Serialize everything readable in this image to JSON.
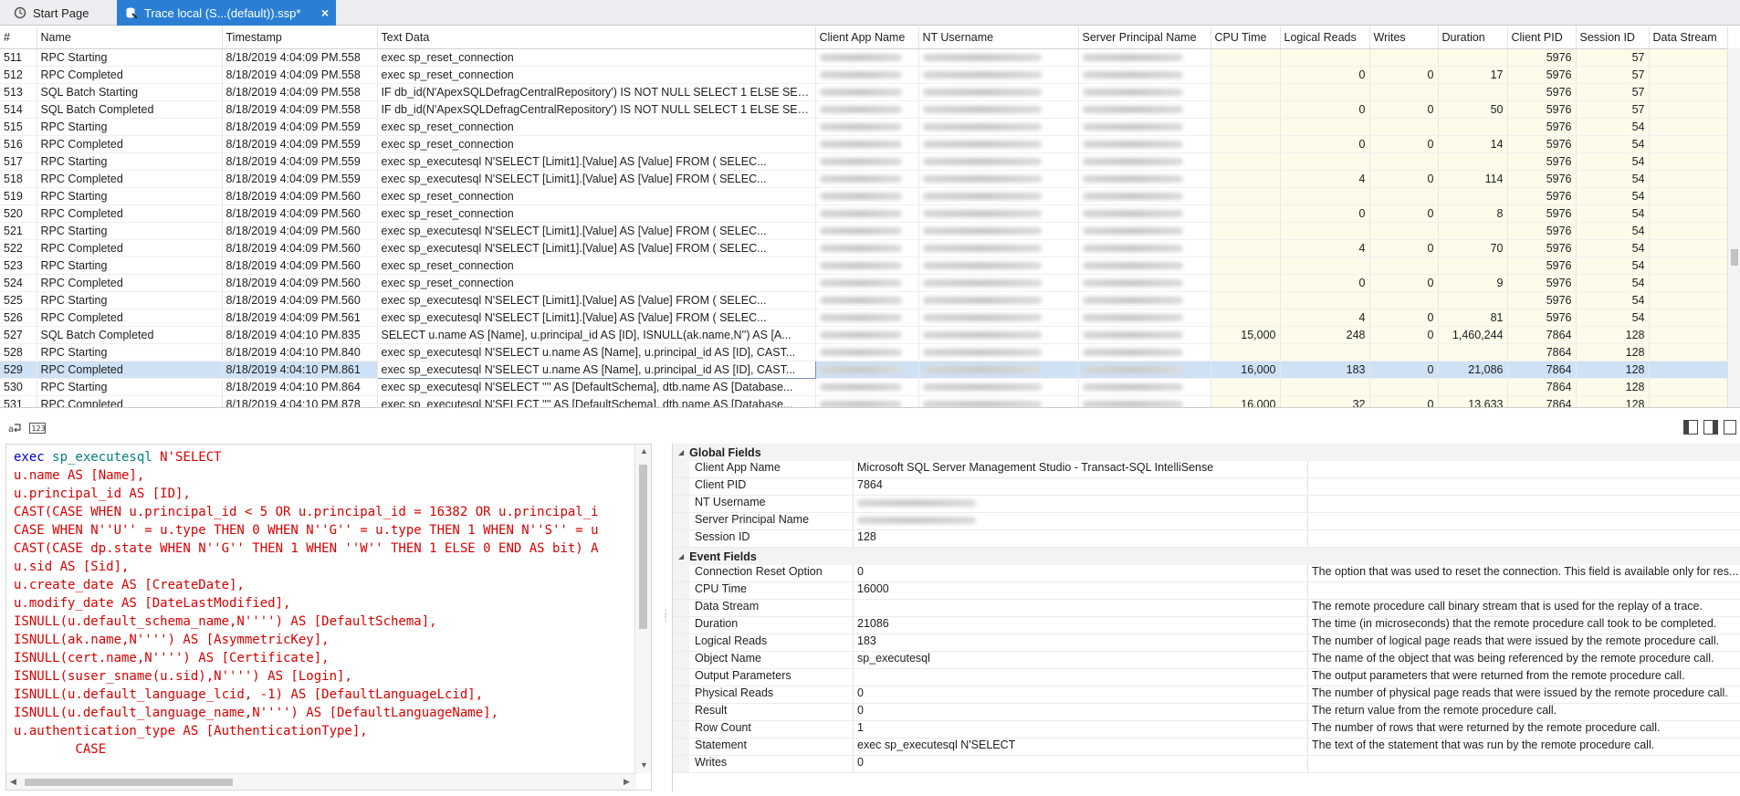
{
  "tabs": [
    {
      "label": "Start Page",
      "icon": "start-page-icon"
    },
    {
      "label": "Trace local (S...(default)).ssp*",
      "icon": "trace-file-icon",
      "close": "×"
    }
  ],
  "grid": {
    "columns": [
      "#",
      "Name",
      "Timestamp",
      "Text Data",
      "Client App Name",
      "NT Username",
      "Server Principal Name",
      "CPU Time",
      "Logical Reads",
      "Writes",
      "Duration",
      "Client PID",
      "Session ID",
      "Data Stream"
    ],
    "rows": [
      {
        "id": "511",
        "name": "RPC Starting",
        "ts": "8/18/2019 4:04:09 PM.558",
        "text": "exec sp_reset_connection",
        "cpu": "",
        "lr": "",
        "wr": "",
        "dur": "",
        "pid": "5976",
        "sid": "57"
      },
      {
        "id": "512",
        "name": "RPC Completed",
        "ts": "8/18/2019 4:04:09 PM.558",
        "text": "exec sp_reset_connection",
        "cpu": "",
        "lr": "0",
        "wr": "0",
        "dur": "17",
        "pid": "5976",
        "sid": "57"
      },
      {
        "id": "513",
        "name": "SQL Batch Starting",
        "ts": "8/18/2019 4:04:09 PM.558",
        "text": "IF db_id(N'ApexSQLDefragCentralRepository') IS NOT NULL SELECT 1 ELSE SEL...",
        "cpu": "",
        "lr": "",
        "wr": "",
        "dur": "",
        "pid": "5976",
        "sid": "57"
      },
      {
        "id": "514",
        "name": "SQL Batch Completed",
        "ts": "8/18/2019 4:04:09 PM.558",
        "text": "IF db_id(N'ApexSQLDefragCentralRepository') IS NOT NULL SELECT 1 ELSE SEL...",
        "cpu": "",
        "lr": "0",
        "wr": "0",
        "dur": "50",
        "pid": "5976",
        "sid": "57"
      },
      {
        "id": "515",
        "name": "RPC Starting",
        "ts": "8/18/2019 4:04:09 PM.559",
        "text": "exec sp_reset_connection",
        "cpu": "",
        "lr": "",
        "wr": "",
        "dur": "",
        "pid": "5976",
        "sid": "54"
      },
      {
        "id": "516",
        "name": "RPC Completed",
        "ts": "8/18/2019 4:04:09 PM.559",
        "text": "exec sp_reset_connection",
        "cpu": "",
        "lr": "0",
        "wr": "0",
        "dur": "14",
        "pid": "5976",
        "sid": "54"
      },
      {
        "id": "517",
        "name": "RPC Starting",
        "ts": "8/18/2019 4:04:09 PM.559",
        "text": "exec sp_executesql N'SELECT      [Limit1].[Value] AS [Value]      FROM ( SELEC...",
        "cpu": "",
        "lr": "",
        "wr": "",
        "dur": "",
        "pid": "5976",
        "sid": "54"
      },
      {
        "id": "518",
        "name": "RPC Completed",
        "ts": "8/18/2019 4:04:09 PM.559",
        "text": "exec sp_executesql N'SELECT      [Limit1].[Value] AS [Value]      FROM ( SELEC...",
        "cpu": "",
        "lr": "4",
        "wr": "0",
        "dur": "114",
        "pid": "5976",
        "sid": "54"
      },
      {
        "id": "519",
        "name": "RPC Starting",
        "ts": "8/18/2019 4:04:09 PM.560",
        "text": "exec sp_reset_connection",
        "cpu": "",
        "lr": "",
        "wr": "",
        "dur": "",
        "pid": "5976",
        "sid": "54"
      },
      {
        "id": "520",
        "name": "RPC Completed",
        "ts": "8/18/2019 4:04:09 PM.560",
        "text": "exec sp_reset_connection",
        "cpu": "",
        "lr": "0",
        "wr": "0",
        "dur": "8",
        "pid": "5976",
        "sid": "54"
      },
      {
        "id": "521",
        "name": "RPC Starting",
        "ts": "8/18/2019 4:04:09 PM.560",
        "text": "exec sp_executesql N'SELECT      [Limit1].[Value] AS [Value]      FROM ( SELEC...",
        "cpu": "",
        "lr": "",
        "wr": "",
        "dur": "",
        "pid": "5976",
        "sid": "54"
      },
      {
        "id": "522",
        "name": "RPC Completed",
        "ts": "8/18/2019 4:04:09 PM.560",
        "text": "exec sp_executesql N'SELECT      [Limit1].[Value] AS [Value]      FROM ( SELEC...",
        "cpu": "",
        "lr": "4",
        "wr": "0",
        "dur": "70",
        "pid": "5976",
        "sid": "54"
      },
      {
        "id": "523",
        "name": "RPC Starting",
        "ts": "8/18/2019 4:04:09 PM.560",
        "text": "exec sp_reset_connection",
        "cpu": "",
        "lr": "",
        "wr": "",
        "dur": "",
        "pid": "5976",
        "sid": "54"
      },
      {
        "id": "524",
        "name": "RPC Completed",
        "ts": "8/18/2019 4:04:09 PM.560",
        "text": "exec sp_reset_connection",
        "cpu": "",
        "lr": "0",
        "wr": "0",
        "dur": "9",
        "pid": "5976",
        "sid": "54"
      },
      {
        "id": "525",
        "name": "RPC Starting",
        "ts": "8/18/2019 4:04:09 PM.560",
        "text": "exec sp_executesql N'SELECT      [Limit1].[Value] AS [Value]      FROM ( SELEC...",
        "cpu": "",
        "lr": "",
        "wr": "",
        "dur": "",
        "pid": "5976",
        "sid": "54"
      },
      {
        "id": "526",
        "name": "RPC Completed",
        "ts": "8/18/2019 4:04:09 PM.561",
        "text": "exec sp_executesql N'SELECT      [Limit1].[Value] AS [Value]      FROM ( SELEC...",
        "cpu": "",
        "lr": "4",
        "wr": "0",
        "dur": "81",
        "pid": "5976",
        "sid": "54"
      },
      {
        "id": "527",
        "name": "SQL Batch Completed",
        "ts": "8/18/2019 4:04:10 PM.835",
        "text": "SELECT u.name AS [Name], u.principal_id AS [ID], ISNULL(ak.name,N'') AS [A...",
        "cpu": "15,000",
        "lr": "248",
        "wr": "0",
        "dur": "1,460,244",
        "pid": "7864",
        "sid": "128"
      },
      {
        "id": "528",
        "name": "RPC Starting",
        "ts": "8/18/2019 4:04:10 PM.840",
        "text": "exec sp_executesql N'SELECT u.name AS [Name], u.principal_id AS [ID], CAST...",
        "cpu": "",
        "lr": "",
        "wr": "",
        "dur": "",
        "pid": "7864",
        "sid": "128"
      },
      {
        "id": "529",
        "name": "RPC Completed",
        "ts": "8/18/2019 4:04:10 PM.861",
        "text": "exec sp_executesql N'SELECT u.name AS [Name], u.principal_id AS [ID], CAST...",
        "cpu": "16,000",
        "lr": "183",
        "wr": "0",
        "dur": "21,086",
        "pid": "7864",
        "sid": "128",
        "selected": true
      },
      {
        "id": "530",
        "name": "RPC Starting",
        "ts": "8/18/2019 4:04:10 PM.864",
        "text": "exec sp_executesql N'SELECT '''' AS [DefaultSchema], dtb.name AS [Database...",
        "cpu": "",
        "lr": "",
        "wr": "",
        "dur": "",
        "pid": "7864",
        "sid": "128"
      },
      {
        "id": "531",
        "name": "RPC Completed",
        "ts": "8/18/2019 4:04:10 PM.878",
        "text": "exec sp_executesql N'SELECT '''' AS [DefaultSchema], dtb.name AS [Database...",
        "cpu": "16,000",
        "lr": "32",
        "wr": "0",
        "dur": "13,633",
        "pid": "7864",
        "sid": "128"
      }
    ]
  },
  "toolbar": {
    "left_icons": [
      "wrap-text-icon",
      "numbers-icon"
    ],
    "right_icons": [
      "layout-left-icon",
      "layout-right-icon",
      "layout-split-icon"
    ]
  },
  "editor": {
    "lines": [
      "exec sp_executesql N'SELECT",
      "u.name AS [Name],",
      "u.principal_id AS [ID],",
      "CAST(CASE WHEN u.principal_id < 5 OR u.principal_id = 16382 OR u.principal_i",
      "CASE WHEN N''U'' = u.type THEN 0 WHEN N''G'' = u.type THEN 1 WHEN N''S'' = u",
      "CAST(CASE dp.state WHEN N''G'' THEN 1 WHEN ''W'' THEN 1 ELSE 0 END AS bit) A",
      "u.sid AS [Sid],",
      "u.create_date AS [CreateDate],",
      "u.modify_date AS [DateLastModified],",
      "ISNULL(u.default_schema_name,N'''') AS [DefaultSchema],",
      "ISNULL(ak.name,N'''') AS [AsymmetricKey],",
      "ISNULL(cert.name,N'''') AS [Certificate],",
      "ISNULL(suser_sname(u.sid),N'''') AS [Login],",
      "ISNULL(u.default_language_lcid, -1) AS [DefaultLanguageLcid],",
      "ISNULL(u.default_language_name,N'''') AS [DefaultLanguageName],",
      "u.authentication_type AS [AuthenticationType],",
      "",
      "        CASE"
    ]
  },
  "properties": {
    "global_title": "Global Fields",
    "global": [
      {
        "name": "Client App Name",
        "value": "Microsoft SQL Server Management Studio - Transact-SQL IntelliSense",
        "desc": ""
      },
      {
        "name": "Client PID",
        "value": "7864",
        "desc": ""
      },
      {
        "name": "NT Username",
        "value": "",
        "desc": "",
        "blurred": true
      },
      {
        "name": "Server Principal Name",
        "value": "",
        "desc": "",
        "blurred": true
      },
      {
        "name": "Session ID",
        "value": "128",
        "desc": ""
      }
    ],
    "event_title": "Event Fields",
    "event": [
      {
        "name": "Connection Reset Option",
        "value": "0",
        "desc": "The option that was used to reset the connection. This field is available only for res..."
      },
      {
        "name": "CPU Time",
        "value": "16000",
        "desc": ""
      },
      {
        "name": "Data Stream",
        "value": "",
        "desc": "The remote procedure call binary stream that is used for the replay of a trace."
      },
      {
        "name": "Duration",
        "value": "21086",
        "desc": "The time (in microseconds) that the remote procedure call took to be completed."
      },
      {
        "name": "Logical Reads",
        "value": "183",
        "desc": "The number of logical page reads that were issued by the remote procedure call."
      },
      {
        "name": "Object Name",
        "value": "sp_executesql",
        "desc": "The name of the object that was being referenced by the remote procedure call."
      },
      {
        "name": "Output Parameters",
        "value": "",
        "desc": "The output parameters that were returned from the remote procedure call."
      },
      {
        "name": "Physical Reads",
        "value": "0",
        "desc": "The number of physical page reads that were issued by the remote procedure call."
      },
      {
        "name": "Result",
        "value": "0",
        "desc": "The return value from the remote procedure call."
      },
      {
        "name": "Row Count",
        "value": "1",
        "desc": "The number of rows that were returned by the remote procedure call."
      },
      {
        "name": "Statement",
        "value": "exec sp_executesql N'SELECT",
        "desc": "The text of the statement that was run by the remote procedure call."
      },
      {
        "name": "Writes",
        "value": "0",
        "desc": ""
      }
    ]
  },
  "colors": {
    "tab_active": "#2a7fd4",
    "selected_row": "#cfe1f5",
    "sql_string": "#d80000",
    "sql_keyword": "#0000c8",
    "sql_function": "#008080",
    "numeric_cell_tint": "#fdfbe9"
  }
}
